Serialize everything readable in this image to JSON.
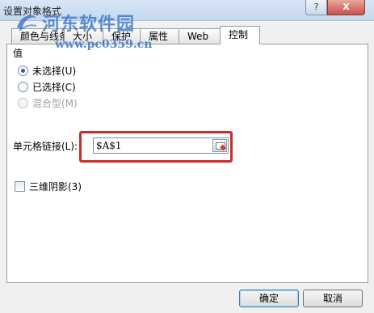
{
  "window": {
    "title": "设置对象格式",
    "help_label": "?",
    "close_label": "X"
  },
  "tabs": [
    {
      "label": "颜色与线条",
      "active": false
    },
    {
      "label": "大小",
      "active": false
    },
    {
      "label": "保护",
      "active": false
    },
    {
      "label": "属性",
      "active": false
    },
    {
      "label": "Web",
      "active": false
    },
    {
      "label": "控制",
      "active": true
    }
  ],
  "value_group": {
    "label": "值",
    "options": [
      {
        "label": "未选择(U)",
        "checked": true,
        "enabled": true
      },
      {
        "label": "已选择(C)",
        "checked": false,
        "enabled": true
      },
      {
        "label": "混合型(M)",
        "checked": false,
        "enabled": false
      }
    ]
  },
  "cell_link": {
    "label": "单元格链接(L):",
    "value": "$A$1"
  },
  "shading": {
    "label": "三维阴影(3)",
    "checked": false
  },
  "buttons": {
    "ok": "确定",
    "cancel": "取消"
  },
  "watermark": {
    "text": "河东软件园",
    "url": "www.pc0359.cn"
  },
  "colors": {
    "highlight": "#cc2b2b",
    "watermark": "#286ec8"
  }
}
